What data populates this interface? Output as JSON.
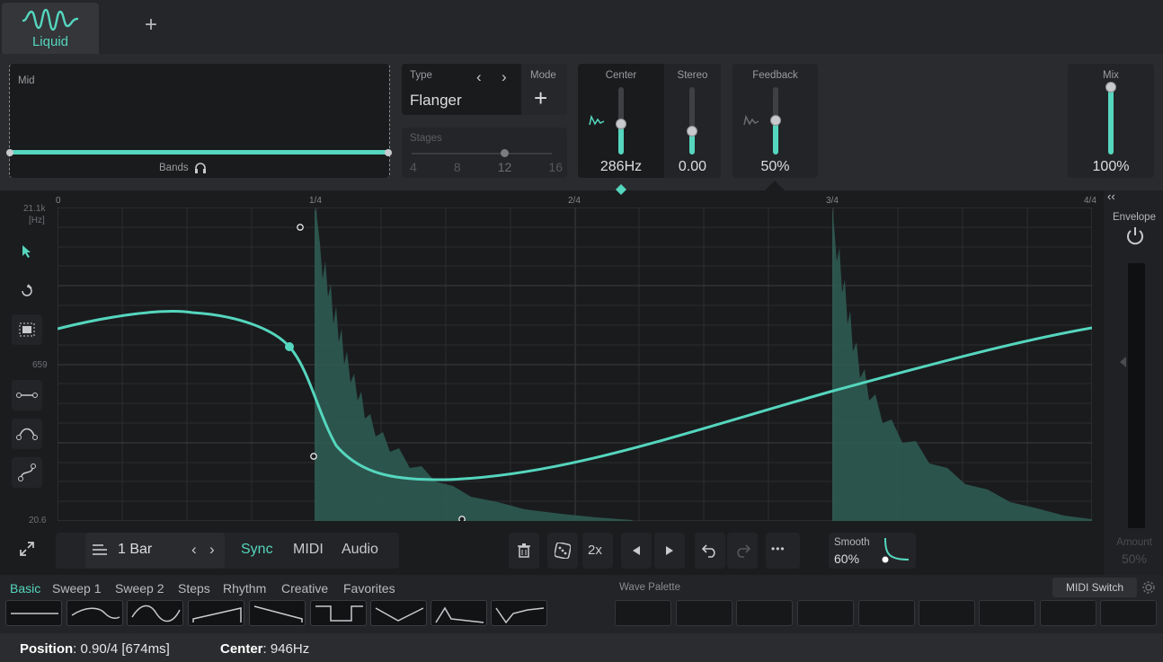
{
  "tabs": {
    "active_label": "Liquid",
    "add_label": "+"
  },
  "band": {
    "title": "Mid",
    "bands_label": "Bands"
  },
  "type": {
    "label": "Type",
    "value": "Flanger",
    "prev": "‹",
    "next": "›",
    "mode_label": "Mode",
    "mode_add": "+"
  },
  "stages": {
    "label": "Stages",
    "options": [
      "4",
      "8",
      "12",
      "16"
    ],
    "selected": "12"
  },
  "center": {
    "label": "Center",
    "value": "286Hz",
    "level": 0.45
  },
  "stereo": {
    "label": "Stereo",
    "value": "0.00",
    "level": 0.35
  },
  "feedback": {
    "label": "Feedback",
    "value": "50%",
    "level": 0.5
  },
  "mix": {
    "label": "Mix",
    "value": "100%",
    "level": 1.0
  },
  "graph": {
    "x_ticks": [
      "0",
      "1/4",
      "2/4",
      "3/4",
      "4/4"
    ],
    "y_top": "21.1k",
    "y_unit": "[Hz]",
    "y_mid": "659",
    "y_bottom": "20.6"
  },
  "envelope": {
    "label": "Envelope",
    "collapse": "‹‹",
    "amount_label": "Amount",
    "amount_value": "50%"
  },
  "transport": {
    "length": "1 Bar",
    "prev": "‹",
    "next": "›",
    "sync": "Sync",
    "midi": "MIDI",
    "audio": "Audio",
    "multiplier": "2x",
    "more": "•••",
    "smooth_label": "Smooth",
    "smooth_value": "60%"
  },
  "preset_tabs": [
    "Basic",
    "Sweep 1",
    "Sweep 2",
    "Steps",
    "Rhythm",
    "Creative",
    "Favorites"
  ],
  "wave_palette_label": "Wave Palette",
  "midi_switch_label": "MIDI Switch",
  "status": {
    "position_label": "Position",
    "position_value": ": 0.90/4 [674ms]",
    "center_label": "Center",
    "center_value": ": 946Hz"
  },
  "colors": {
    "accent": "#55d6be",
    "background": "#1b1c1e",
    "panel": "#2a2b2e"
  }
}
